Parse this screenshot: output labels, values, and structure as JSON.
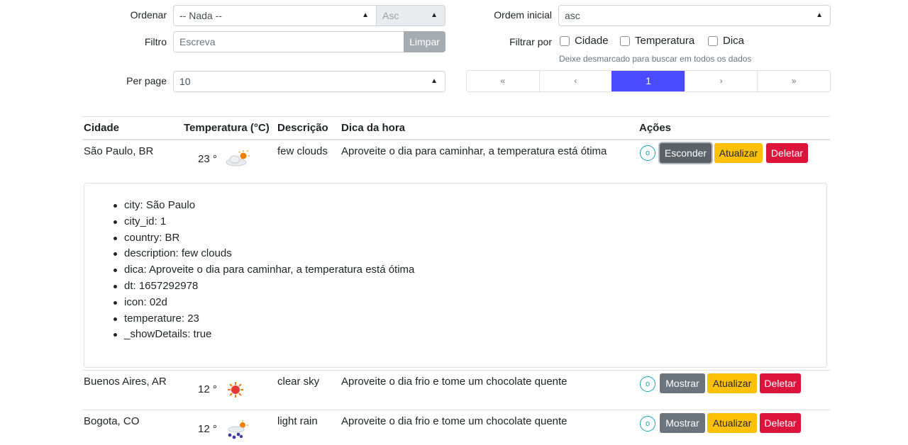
{
  "controls": {
    "ordenar_label": "Ordenar",
    "ordenar_value": "-- Nada --",
    "asc_value": "Asc",
    "ordem_label": "Ordem inicial",
    "ordem_value": "asc",
    "filtro_label": "Filtro",
    "filtro_placeholder": "Escreva",
    "limpar": "Limpar",
    "filtrar_label": "Filtrar por",
    "checkboxes": [
      "Cidade",
      "Temperatura",
      "Dica"
    ],
    "hint": "Deixe desmarcado para buscar em todos os dados",
    "perpage_label": "Per page",
    "perpage_value": "10",
    "pager": [
      "«",
      "‹",
      "1",
      "›",
      "»"
    ]
  },
  "table": {
    "headers": [
      "Cidade",
      "Temperatura (°C)",
      "Descrição",
      "Dica da hora",
      "Ações"
    ],
    "rows": [
      {
        "city": "São Paulo, BR",
        "temp": "23 °",
        "desc": "few clouds",
        "tip": "Aproveite o dia para caminhar, a temperatura está ótima",
        "icon": "few-clouds-icon",
        "toggle": "Esconder",
        "update": "Atualizar",
        "delete": "Deletar",
        "circle": "o"
      },
      {
        "city": "Buenos Aires, AR",
        "temp": "12 °",
        "desc": "clear sky",
        "tip": "Aproveite o dia frio e tome um chocolate quente",
        "icon": "sun-icon",
        "toggle": "Mostrar",
        "update": "Atualizar",
        "delete": "Deletar",
        "circle": "o"
      },
      {
        "city": "Bogota, CO",
        "temp": "12 °",
        "desc": "light rain",
        "tip": "Aproveite o dia frio e tome um chocolate quente",
        "icon": "rain-icon",
        "toggle": "Mostrar",
        "update": "Atualizar",
        "delete": "Deletar",
        "circle": "o"
      }
    ]
  },
  "details": [
    "city: São Paulo",
    "city_id: 1",
    "country: BR",
    "description: few clouds",
    "dica: Aproveite o dia para caminhar, a temperatura está ótima",
    "dt: 1657292978",
    "icon: 02d",
    "temperature: 23",
    "_showDetails: true"
  ],
  "colors": {
    "accent": "#4b4cff",
    "warning": "#ffc107",
    "danger": "#dc143c",
    "secondary": "#6c757d",
    "info": "#17a2b8"
  }
}
